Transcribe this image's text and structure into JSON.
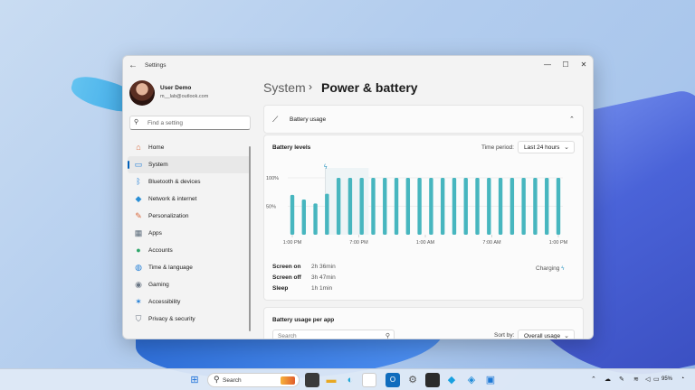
{
  "window": {
    "title": "Settings",
    "controls": {
      "minimize": "—",
      "maximize": "☐",
      "close": "✕"
    }
  },
  "user": {
    "name": "User Demo",
    "email": "m__lab@outlook.com"
  },
  "search": {
    "placeholder": "Find a setting"
  },
  "sidebar": {
    "items": [
      {
        "label": "Home",
        "icon": "home-icon"
      },
      {
        "label": "System",
        "icon": "system-icon",
        "selected": true
      },
      {
        "label": "Bluetooth & devices",
        "icon": "bluetooth-icon"
      },
      {
        "label": "Network & internet",
        "icon": "wifi-icon"
      },
      {
        "label": "Personalization",
        "icon": "brush-icon"
      },
      {
        "label": "Apps",
        "icon": "apps-icon"
      },
      {
        "label": "Accounts",
        "icon": "account-icon"
      },
      {
        "label": "Time & language",
        "icon": "globe-clock-icon"
      },
      {
        "label": "Gaming",
        "icon": "gamepad-icon"
      },
      {
        "label": "Accessibility",
        "icon": "accessibility-icon"
      },
      {
        "label": "Privacy & security",
        "icon": "shield-icon"
      }
    ]
  },
  "breadcrumb": {
    "parent": "System",
    "separator": "›",
    "current": "Power & battery"
  },
  "battery_usage": {
    "header": "Battery usage",
    "levels_label": "Battery levels",
    "time_period_label": "Time period:",
    "time_period_value": "Last 24 hours",
    "charging_label": "Charging",
    "stats": [
      {
        "label": "Screen on",
        "value": "2h 36min"
      },
      {
        "label": "Screen off",
        "value": "3h 47min"
      },
      {
        "label": "Sleep",
        "value": "1h 1min"
      }
    ]
  },
  "per_app": {
    "title": "Battery usage per app",
    "search_placeholder": "Search",
    "sort_label": "Sort by:",
    "sort_value": "Overall usage"
  },
  "chart_data": {
    "type": "bar",
    "x_tick_labels": [
      "1:00 PM",
      "7:00 PM",
      "1:00 AM",
      "7:00 AM",
      "1:00 PM"
    ],
    "y_tick_labels": [
      "100%",
      "50%"
    ],
    "ylim": [
      0,
      100
    ],
    "values": [
      70,
      62,
      55,
      72,
      100,
      100,
      100,
      100,
      100,
      100,
      100,
      100,
      100,
      100,
      100,
      100,
      100,
      100,
      100,
      100,
      100,
      100,
      100,
      100
    ],
    "bar_color": "#47b6bf",
    "highlight_index": 3,
    "grid": true
  },
  "taskbar": {
    "search_label": "Search",
    "battery_percent": "95%",
    "apps": [
      "windows-icon",
      "file-explorer-icon",
      "edge-icon",
      "folder-icon",
      "outlook-icon",
      "store-icon",
      "settings-icon",
      "terminal-icon",
      "photos-icon",
      "dev-icon",
      "remote-icon"
    ]
  },
  "colors": {
    "accent": "#005fb8",
    "chart_bar": "#47b6bf"
  }
}
